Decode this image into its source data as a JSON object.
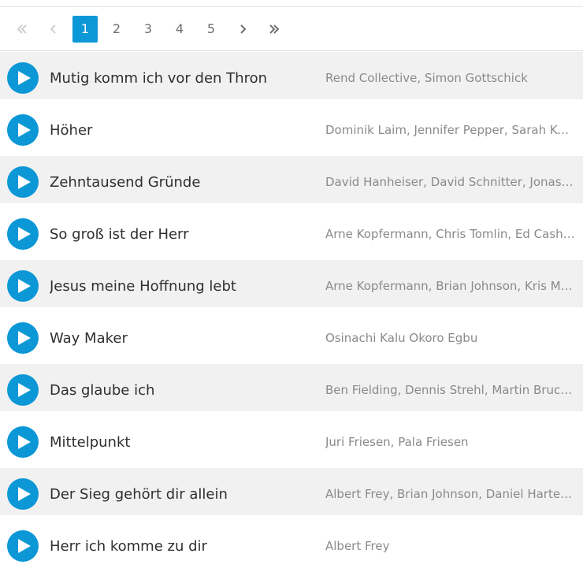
{
  "pagination": {
    "first_icon": "double-chevron-left-icon",
    "prev_icon": "chevron-left-icon",
    "pages": [
      "1",
      "2",
      "3",
      "4",
      "5"
    ],
    "active_page": "1",
    "next_icon": "chevron-right-icon",
    "last_icon": "double-chevron-right-icon"
  },
  "colors": {
    "accent": "#0c97d6",
    "row_shade": "#f1f1f1",
    "title_text": "#2f2f2f",
    "author_text": "#8a8a8a"
  },
  "songs": [
    {
      "title": "Mutig komm ich vor den Thron",
      "authors": "Rend Collective, Simon Gottschick",
      "play_icon": "play-icon"
    },
    {
      "title": "Höher",
      "authors": "Dominik Laim, Jennifer Pepper, Sarah Keim,...",
      "play_icon": "play-icon"
    },
    {
      "title": "Zehntausend Gründe",
      "authors": "David Hanheiser, David Schnitter, Jonas My...",
      "play_icon": "play-icon"
    },
    {
      "title": "So groß ist der Herr",
      "authors": "Arne Kopfermann, Chris Tomlin, Ed Cash, Je...",
      "play_icon": "play-icon"
    },
    {
      "title": "Jesus meine Hoffnung lebt",
      "authors": "Arne Kopfermann, Brian Johnson, Kris Mada...",
      "play_icon": "play-icon"
    },
    {
      "title": "Way Maker",
      "authors": "Osinachi Kalu Okoro Egbu",
      "play_icon": "play-icon"
    },
    {
      "title": "Das glaube ich",
      "authors": "Ben Fielding, Dennis Strehl, Martin Bruch, ...",
      "play_icon": "play-icon"
    },
    {
      "title": "Mittelpunkt",
      "authors": "Juri Friesen, Pala Friesen",
      "play_icon": "play-icon"
    },
    {
      "title": "Der Sieg gehört dir allein",
      "authors": "Albert Frey, Brian Johnson, Daniel Harter, P...",
      "play_icon": "play-icon"
    },
    {
      "title": "Herr ich komme zu dir",
      "authors": "Albert Frey",
      "play_icon": "play-icon"
    }
  ]
}
